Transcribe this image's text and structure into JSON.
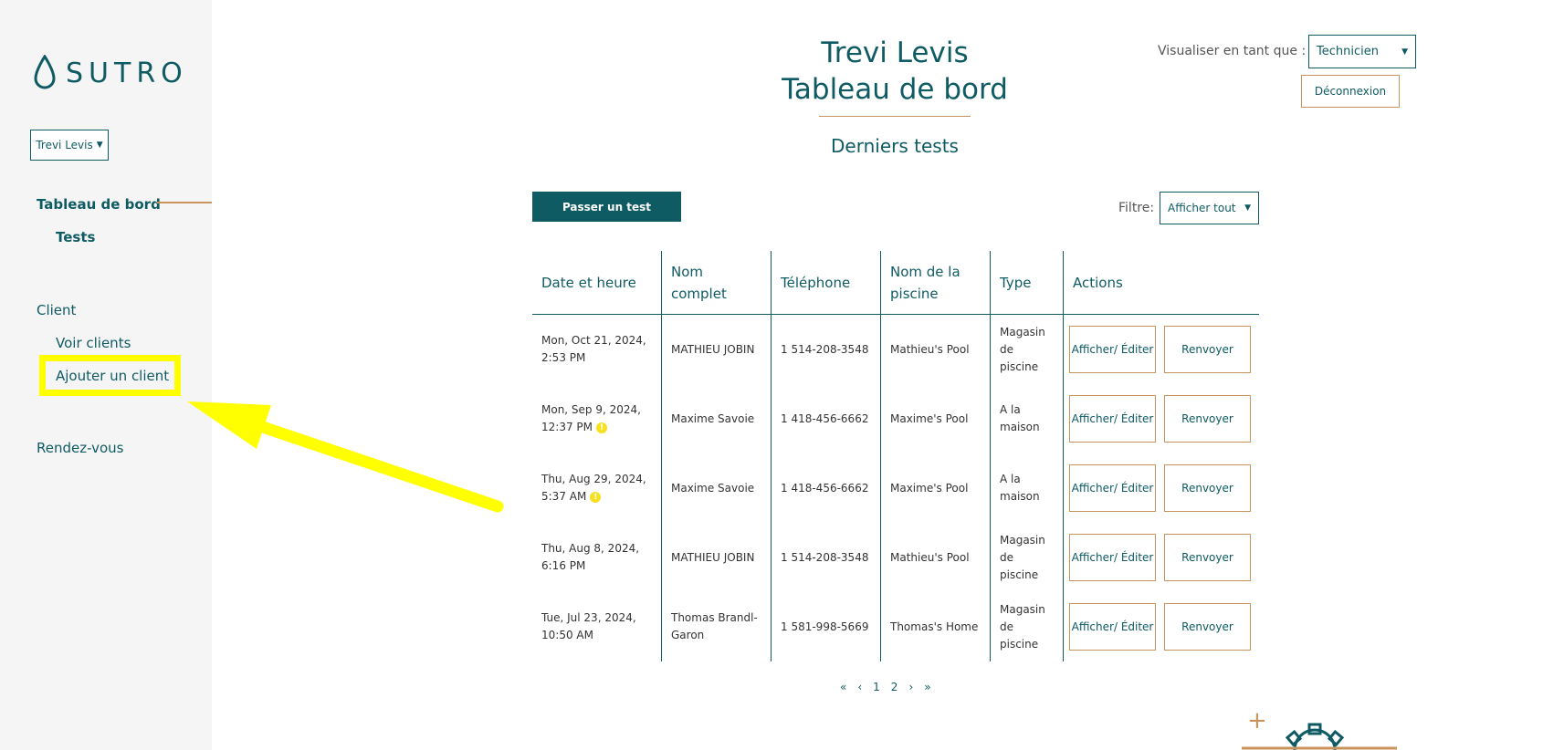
{
  "brand": {
    "name": "SUTRO"
  },
  "sidebar": {
    "store_select": "Trevi Levis",
    "nav": {
      "dashboard": "Tableau de bord",
      "tests": "Tests",
      "client": "Client",
      "view_clients": "Voir clients",
      "add_client": "Ajouter un client",
      "appointments": "Rendez-vous"
    }
  },
  "header": {
    "store_name": "Trevi Levis",
    "page_title": "Tableau de bord",
    "section_title": "Derniers tests",
    "view_as_label": "Visualiser en tant que :",
    "view_as_value": "Technicien",
    "logout": "Déconnexion"
  },
  "toolbar": {
    "new_test": "Passer un test",
    "filter_label": "Filtre:",
    "filter_value": "Afficher tout"
  },
  "table": {
    "headers": [
      "Date et heure",
      "Nom complet",
      "Téléphone",
      "Nom de la piscine",
      "Type",
      "Actions"
    ],
    "rows": [
      {
        "date": "Mon, Oct 21, 2024, 2:53 PM",
        "name": "MATHIEU JOBIN",
        "phone": "1 514-208-3548",
        "pool": "Mathieu's Pool",
        "type": "Magasin de piscine",
        "warning": false
      },
      {
        "date": "Mon, Sep 9, 2024, 12:37 PM",
        "name": "Maxime Savoie",
        "phone": "1 418-456-6662",
        "pool": "Maxime's Pool",
        "type": "A la maison",
        "warning": true
      },
      {
        "date": "Thu, Aug 29, 2024, 5:37 AM",
        "name": "Maxime Savoie",
        "phone": "1 418-456-6662",
        "pool": "Maxime's Pool",
        "type": "A la maison",
        "warning": true
      },
      {
        "date": "Thu, Aug 8, 2024, 6:16 PM",
        "name": "MATHIEU JOBIN",
        "phone": "1 514-208-3548",
        "pool": "Mathieu's Pool",
        "type": "Magasin de piscine",
        "warning": false
      },
      {
        "date": "Tue, Jul 23, 2024, 10:50 AM",
        "name": "Thomas Brandl-Garon",
        "phone": "1 581-998-5669",
        "pool": "Thomas's Home",
        "type": "Magasin de piscine",
        "warning": false
      }
    ],
    "action_edit": "Afficher/ Éditer",
    "action_resend": "Renvoyer",
    "warning_glyph": "!"
  },
  "pagination": {
    "first": "«",
    "prev": "‹",
    "pages": [
      "1",
      "2"
    ],
    "next": "›",
    "last": "»"
  },
  "colors": {
    "primary": "#0f5b63",
    "accent": "#c8935c",
    "sidebar_bg": "#f5f5f5",
    "annotation": "#ffff00"
  },
  "icons": {
    "logo": "water-drop-icon",
    "select_chevron": "chevron-down-icon",
    "warning": "warning-dot-icon",
    "add": "plus-icon",
    "gear": "gear-icon"
  }
}
